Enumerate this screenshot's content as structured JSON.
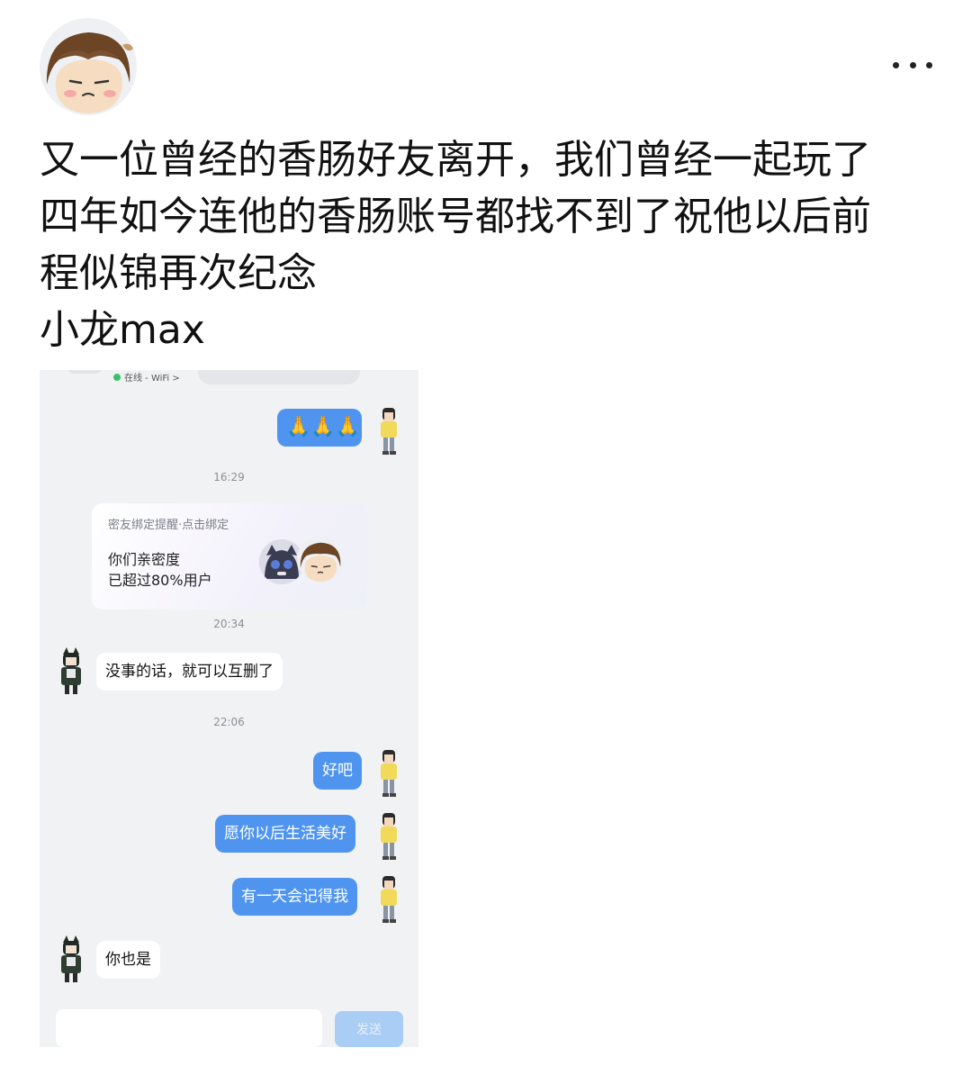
{
  "post": {
    "lines": [
      "又一位曾经的香肠好友离开，我们曾经一起玩了",
      "四年如今连他的香肠账号都找不到了祝他以后前",
      "程似锦再次纪念",
      "小龙max"
    ]
  },
  "icons": {
    "more": "more-dots-icon",
    "author_avatar": "cartoon-boy-avatar"
  },
  "chat": {
    "status_text": "在线 - WiFi >",
    "messages": [
      {
        "side": "me",
        "kind": "emoji",
        "text": "🙏🙏🙏"
      },
      {
        "kind": "time",
        "text": "16:29"
      },
      {
        "kind": "card",
        "title": "密友绑定提醒·点击绑定",
        "line1": "你们亲密度",
        "line2": "已超过80%用户"
      },
      {
        "kind": "time",
        "text": "20:34"
      },
      {
        "side": "them",
        "text": "没事的话，就可以互删了"
      },
      {
        "kind": "time",
        "text": "22:06"
      },
      {
        "side": "me",
        "text": "好吧"
      },
      {
        "side": "me",
        "text": "愿你以后生活美好"
      },
      {
        "side": "me",
        "text": "有一天会记得我"
      },
      {
        "side": "them",
        "text": "你也是"
      }
    ],
    "send_label": "发送"
  },
  "colors": {
    "me_bubble": "#4f95ef",
    "chat_bg": "#f1f2f4",
    "send_disabled": "#a9cdf5"
  }
}
